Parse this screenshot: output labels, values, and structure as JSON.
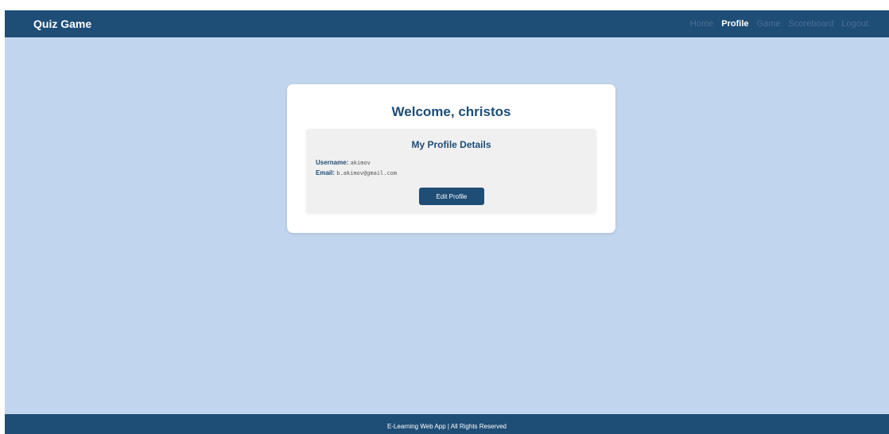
{
  "navbar": {
    "brand": "Quiz Game",
    "links": [
      {
        "label": "Home",
        "active": false
      },
      {
        "label": "Profile",
        "active": true
      },
      {
        "label": "Game",
        "active": false
      },
      {
        "label": "Scoreboard",
        "active": false
      },
      {
        "label": "Logout",
        "active": false
      }
    ]
  },
  "profile": {
    "welcome": "Welcome, christos",
    "details_title": "My Profile Details",
    "username_label": "Username:",
    "username_value": "akimov",
    "email_label": "Email:",
    "email_value": "b.akimov@gmail.com",
    "edit_button": "Edit Profile"
  },
  "footer": {
    "text": "E-Learning Web App | All Rights Reserved"
  },
  "colors": {
    "primary": "#1e4d76",
    "background": "#c2d5ee",
    "card": "#ffffff",
    "panel": "#f0f0f0"
  }
}
